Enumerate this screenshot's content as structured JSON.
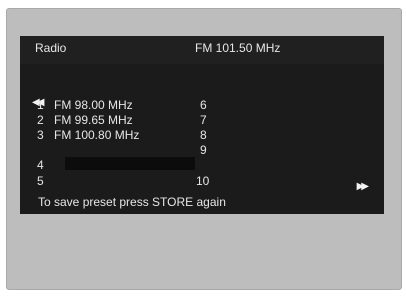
{
  "header": {
    "title": "Radio",
    "frequency": "FM 101.50 MHz"
  },
  "icons": {
    "prev": "skip-back-icon",
    "next": "skip-forward-icon"
  },
  "presets": [
    {
      "number": "1",
      "label": "FM 98.00 MHz"
    },
    {
      "number": "2",
      "label": "FM 99.65 MHz"
    },
    {
      "number": "3",
      "label": "FM 100.80 MHz"
    },
    {
      "number": "4",
      "label": ""
    },
    {
      "number": "5",
      "label": ""
    },
    {
      "number": "6",
      "label": ""
    },
    {
      "number": "7",
      "label": ""
    },
    {
      "number": "8",
      "label": ""
    },
    {
      "number": "9",
      "label": ""
    },
    {
      "number": "10",
      "label": ""
    }
  ],
  "hint": "To save preset press STORE again"
}
